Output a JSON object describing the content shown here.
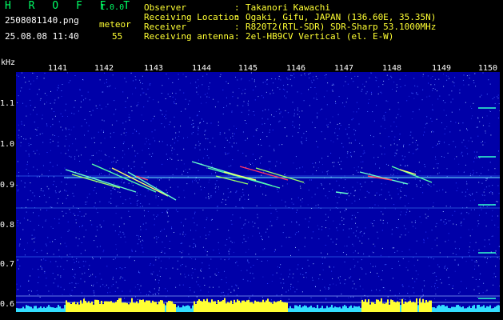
{
  "app": {
    "logo": "H R O F F T",
    "version": "1.0.0"
  },
  "capture": {
    "filename": "2508081140.png",
    "datetime": "25.08.08 11:40",
    "meteor_label": "meteor",
    "meteor_count": "55"
  },
  "station": {
    "observer_label": "Observer",
    "observer": "Takanori Kawachi",
    "location_label": "Receiving Location",
    "location": "Ogaki, Gifu, JAPAN (136.60E, 35.35N)",
    "receiver_label": "Receiver",
    "receiver": "R820T2(RTL-SDR) SDR-Sharp 53.1000MHz",
    "antenna_label": "Receiving antenna",
    "antenna": "2el-HB9CV Vertical (el. E-W)"
  },
  "axis": {
    "unit": "kHz",
    "y_ticks": [
      "1.1",
      "1.0",
      "0.9",
      "0.8",
      "0.7",
      "0.6"
    ],
    "x_ticks": [
      "1141",
      "1142",
      "1143",
      "1144",
      "1145",
      "1146",
      "1147",
      "1148",
      "1149",
      "1150"
    ]
  },
  "colors": {
    "accent_green": "#00ff66",
    "accent_yellow": "#ffff33",
    "background": "#0000a8"
  }
}
